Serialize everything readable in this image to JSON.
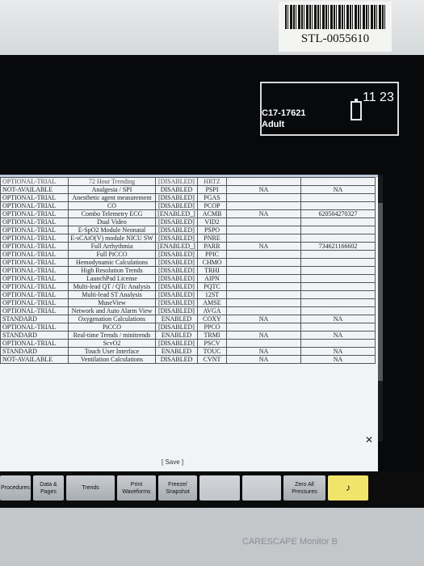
{
  "device": {
    "asset_tag": "STL-0055610",
    "brand": "CARESCAPE Monitor B"
  },
  "header": {
    "patient_id": "C17-17621",
    "patient_type": "Adult",
    "clock": "11 23"
  },
  "table": {
    "partial_top_row": [
      "OPTIONAL-TRIAL",
      "72 Hour Trending",
      "[DISABLED]",
      "HRTZ",
      "",
      ""
    ],
    "rows": [
      [
        "NOT-AVAILABLE",
        "Analgesia / SPI",
        "DISABLED",
        "PSPI",
        "NA",
        "NA"
      ],
      [
        "OPTIONAL-TRIAL",
        "Anesthetic agent measurement",
        "[DISABLED]",
        "PGAS",
        "",
        ""
      ],
      [
        "OPTIONAL-TRIAL",
        "CO",
        "[DISABLED]",
        "PCOP",
        "",
        ""
      ],
      [
        "OPTIONAL-TRIAL",
        "Combo Telemetry ECG",
        "[ENABLED_]",
        "ACMB",
        "NA",
        "620504270327"
      ],
      [
        "OPTIONAL-TRIAL",
        "Dual Video",
        "[DISABLED]",
        "VID2",
        "",
        ""
      ],
      [
        "OPTIONAL-TRIAL",
        "E-SpO2 Module Neonatal",
        "[DISABLED]",
        "PSPO",
        "",
        ""
      ],
      [
        "OPTIONAL-TRIAL",
        "E-sCAiO(V) module NICU SW",
        "[DISABLED]",
        "PNRE",
        "",
        ""
      ],
      [
        "OPTIONAL-TRIAL",
        "Full Arrhythmia",
        "[ENABLED_]",
        "PARR",
        "NA",
        "734621166602"
      ],
      [
        "OPTIONAL-TRIAL",
        "Full PiCCO",
        "[DISABLED]",
        "PPIC",
        "",
        ""
      ],
      [
        "OPTIONAL-TRIAL",
        "Hemodynamic Calculations",
        "[DISABLED]",
        "CHMO",
        "",
        ""
      ],
      [
        "OPTIONAL-TRIAL",
        "High Resolution Trends",
        "[DISABLED]",
        "TRHI",
        "",
        ""
      ],
      [
        "OPTIONAL-TRIAL",
        "LaunchPad License",
        "[DISABLED]",
        "AIPN",
        "",
        ""
      ],
      [
        "OPTIONAL-TRIAL",
        "Multi-lead QT / QTc Analysis",
        "[DISABLED]",
        "PQTC",
        "",
        ""
      ],
      [
        "OPTIONAL-TRIAL",
        "Multi-lead ST Analysis",
        "[DISABLED]",
        "12ST",
        "",
        ""
      ],
      [
        "OPTIONAL-TRIAL",
        "MuseView",
        "[DISABLED]",
        "AMSE",
        "",
        ""
      ],
      [
        "OPTIONAL-TRIAL",
        "Network and Auto Alarm View",
        "[DISABLED]",
        "AVGA",
        "",
        ""
      ],
      [
        "STANDARD",
        "Oxygenation Calculations",
        "ENABLED",
        "COXY",
        "NA",
        "NA"
      ],
      [
        "OPTIONAL-TRIAL",
        "PiCCO",
        "[DISABLED]",
        "PPCO",
        "",
        ""
      ],
      [
        "STANDARD",
        "Real-time Trends / minitrends",
        "ENABLED",
        "TRMI",
        "NA",
        "NA"
      ],
      [
        "OPTIONAL-TRIAL",
        "ScvO2",
        "[DISABLED]",
        "PSCV",
        "",
        ""
      ],
      [
        "STANDARD",
        "Touch User Interface",
        "ENABLED",
        "TOUC",
        "NA",
        "NA"
      ],
      [
        "NOT-AVAILABLE",
        "Ventilation Calculations",
        "DISABLED",
        "CVNT",
        "NA",
        "NA"
      ]
    ],
    "save_label": "[ Save ]"
  },
  "menu": {
    "procedures": "Procedures",
    "data_pages": "Data & Pages",
    "trends": "Trends",
    "print_waveforms": "Print Waveforms",
    "freeze_snapshot": "Freeze/ Snapshot",
    "zero_all": "Zero All Pressures"
  },
  "icons": {
    "battery": "battery-icon",
    "alarm": "alarm-bell-icon",
    "close": "close-icon"
  }
}
